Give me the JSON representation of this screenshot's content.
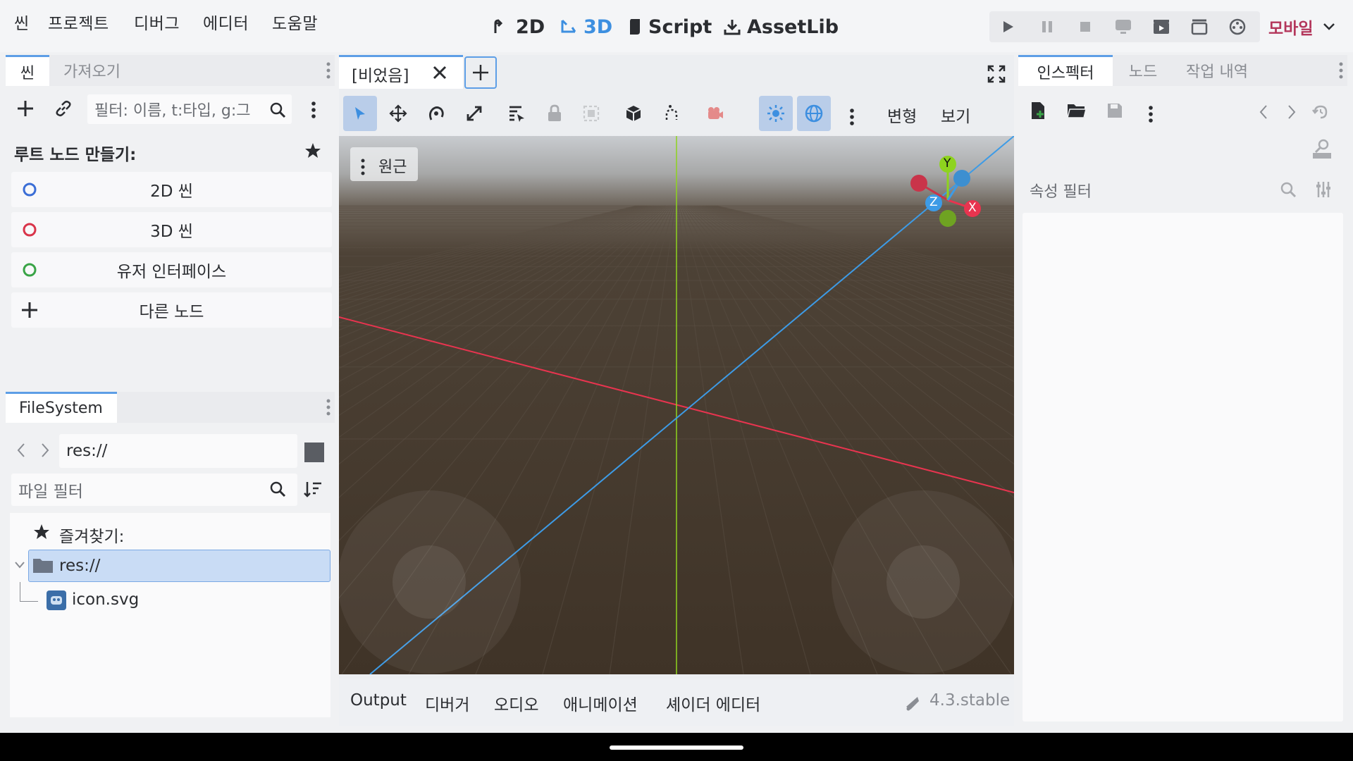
{
  "menu": [
    "씬",
    "프로젝트",
    "디버그",
    "에디터",
    "도움말"
  ],
  "workspaces": {
    "w2d": "2D",
    "w3d": "3D",
    "script": "Script",
    "assetlib": "AssetLib"
  },
  "renderer": "모바일",
  "scene_dock": {
    "tabs": [
      "씬",
      "가져오기"
    ],
    "filter_placeholder": "필터: 이름, t:타입, g:그",
    "create_root_label": "루트 노드 만들기:",
    "buttons": [
      "2D 씬",
      "3D 씬",
      "유저 인터페이스",
      "다른 노드"
    ]
  },
  "filesystem": {
    "tab": "FileSystem",
    "path": "res://",
    "filter_placeholder": "파일 필터",
    "favorites": "즐겨찾기:",
    "folder": "res://",
    "file": "icon.svg"
  },
  "editor_tabs": {
    "current": "[비었음]"
  },
  "viewport_toolbar": {
    "transform": "변형",
    "view": "보기"
  },
  "viewport": {
    "perspective_label": "원근",
    "gizmo": {
      "x": "X",
      "y": "Y",
      "z": "Z"
    }
  },
  "bottom_panel": {
    "tabs": [
      "Output",
      "디버거",
      "오디오",
      "애니메이션",
      "셰이더 에디터"
    ],
    "version": "4.3.stable"
  },
  "inspector": {
    "tabs": [
      "인스펙터",
      "노드",
      "작업 내역"
    ],
    "filter_placeholder": "속성 필터"
  },
  "colors": {
    "accent": "#3d8fe0",
    "renderer": "#b3365b",
    "x_axis": "#e8344f",
    "y_axis": "#8ed31e",
    "z_axis": "#3d9be6"
  }
}
